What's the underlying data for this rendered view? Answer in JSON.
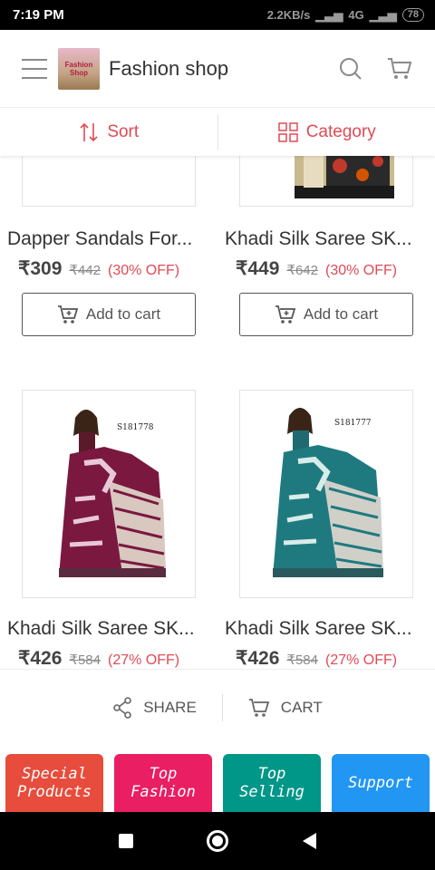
{
  "status_bar": {
    "time": "7:19 PM",
    "network_speed": "2.2KB/s",
    "signal": "4G",
    "battery": "78"
  },
  "header": {
    "app_title": "Fashion shop",
    "logo_text_1": "Fashion",
    "logo_text_2": "Shop"
  },
  "filters": {
    "sort_label": "Sort",
    "category_label": "Category"
  },
  "products": [
    {
      "title": "Dapper Sandals For...",
      "price": "₹309",
      "mrp": "₹442",
      "discount": "(30% OFF)",
      "button": "Add to cart"
    },
    {
      "title": "Khadi Silk Saree SK...",
      "price": "₹449",
      "mrp": "₹642",
      "discount": "(30% OFF)",
      "button": "Add to cart"
    },
    {
      "title": "Khadi Silk Saree SK...",
      "price": "₹426",
      "mrp": "₹584",
      "discount": "(27% OFF)",
      "code": "S181778",
      "saree_color": "#7a1840",
      "border_color": "#5a2a40"
    },
    {
      "title": "Khadi Silk Saree SK...",
      "price": "₹426",
      "mrp": "₹584",
      "discount": "(27% OFF)",
      "code": "S181777",
      "saree_color": "#1f7a80",
      "border_color": "#2a5a5e"
    }
  ],
  "actions": {
    "share_label": "SHARE",
    "cart_label": "CART"
  },
  "tiles": [
    {
      "label": "Special Products",
      "color": "#e74c3c"
    },
    {
      "label": "Top Fashion",
      "color": "#e91e63"
    },
    {
      "label": "Top Selling",
      "color": "#009688"
    },
    {
      "label": "Support",
      "color": "#2196f3"
    }
  ],
  "accent_color": "#e04a55"
}
